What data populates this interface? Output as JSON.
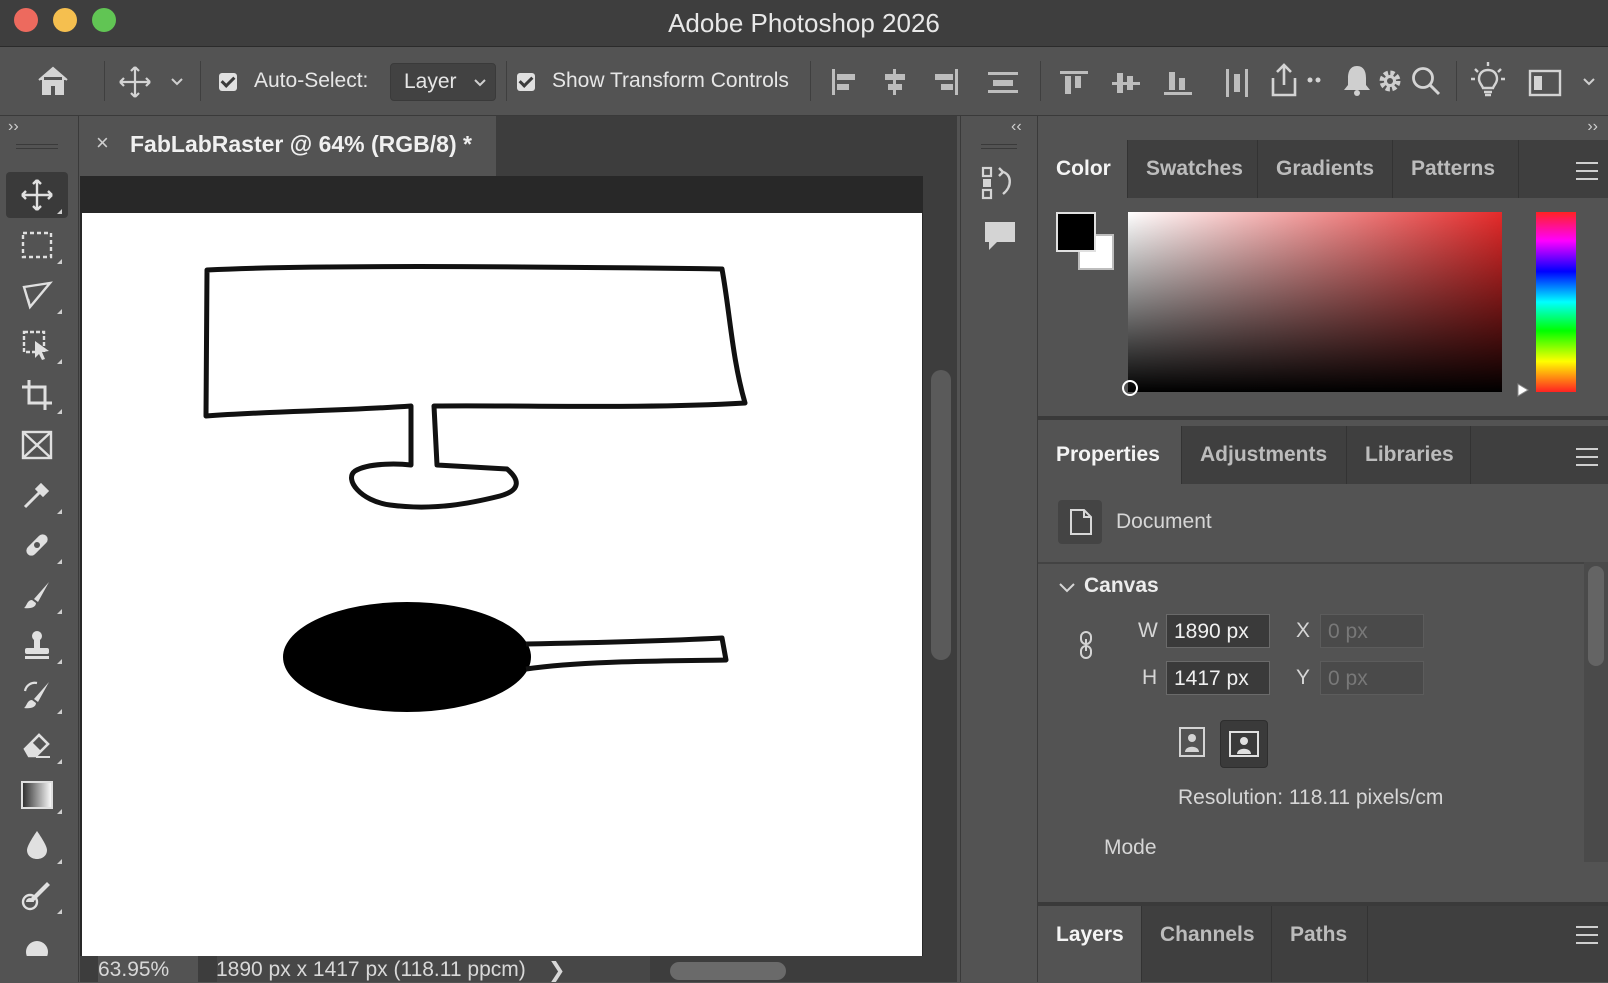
{
  "window": {
    "title": "Adobe Photoshop 2026"
  },
  "options_bar": {
    "auto_select_label": "Auto-Select:",
    "auto_select_value": "Layer",
    "transform_controls_label": "Show Transform Controls"
  },
  "document": {
    "tab_title": "FabLabRaster @ 64% (RGB/8) *",
    "close_glyph": "×",
    "zoom": "63.95%",
    "info": "1890 px x 1417 px (118.11 ppcm)",
    "info_arrow": "❯"
  },
  "tools": [
    "move-tool",
    "rectangular-marquee-tool",
    "lasso-tool",
    "object-selection-tool",
    "crop-tool",
    "frame-tool",
    "eyedropper-tool",
    "spot-healing-tool",
    "brush-tool",
    "clone-stamp-tool",
    "history-brush-tool",
    "eraser-tool",
    "gradient-tool",
    "blur-tool",
    "dodge-tool",
    "pen-tool"
  ],
  "color_panel": {
    "tabs": [
      "Color",
      "Swatches",
      "Gradients",
      "Patterns"
    ],
    "active_tab": "Color",
    "foreground": "#000000",
    "background": "#ffffff",
    "hue": "#e52a2a"
  },
  "properties_panel": {
    "tabs": [
      "Properties",
      "Adjustments",
      "Libraries"
    ],
    "active_tab": "Properties",
    "document_label": "Document",
    "canvas_label": "Canvas",
    "w_label": "W",
    "w_value": "1890 px",
    "h_label": "H",
    "h_value": "1417 px",
    "x_label": "X",
    "x_placeholder": "0 px",
    "y_label": "Y",
    "y_placeholder": "0 px",
    "resolution": "Resolution: 118.11 pixels/cm",
    "mode_label": "Mode"
  },
  "layers_panel": {
    "tabs": [
      "Layers",
      "Channels",
      "Paths"
    ],
    "active_tab": "Layers"
  }
}
